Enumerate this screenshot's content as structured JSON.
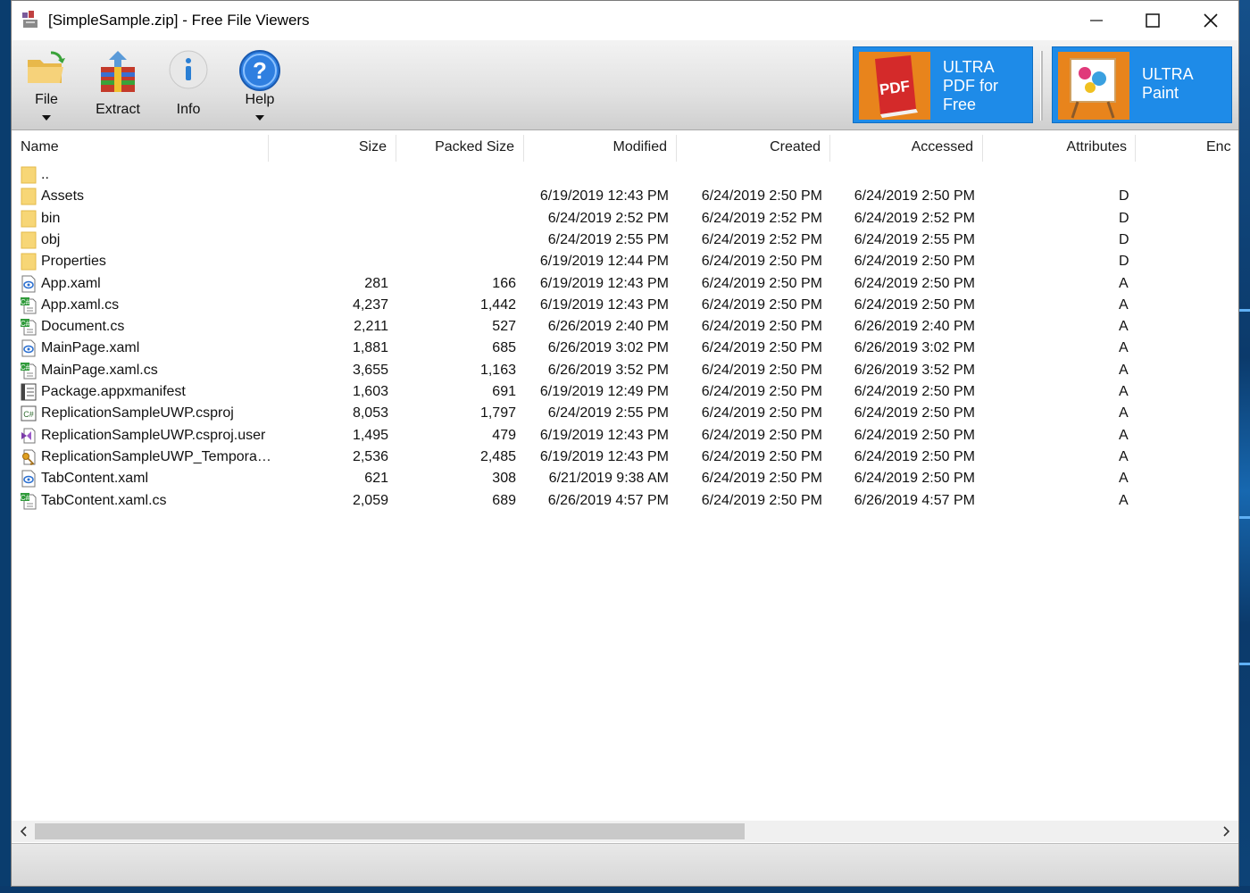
{
  "window": {
    "title": "[SimpleSample.zip] - Free File Viewers"
  },
  "toolbar": {
    "file_label": "File",
    "extract_label": "Extract",
    "info_label": "Info",
    "help_label": "Help"
  },
  "promos": [
    {
      "lines": [
        "ULTRA",
        "PDF for",
        "Free"
      ],
      "thumb_text": "PDF",
      "color": "#1e8be8"
    },
    {
      "lines": [
        "ULTRA",
        "Paint"
      ],
      "color": "#1e8be8"
    }
  ],
  "columns": [
    "Name",
    "Size",
    "Packed Size",
    "Modified",
    "Created",
    "Accessed",
    "Attributes",
    "Enc"
  ],
  "files": [
    {
      "name": "..",
      "size": "",
      "packed": "",
      "modified": "",
      "created": "",
      "accessed": "",
      "attr": "",
      "icon": "folder-icon"
    },
    {
      "name": "Assets",
      "size": "",
      "packed": "",
      "modified": "6/19/2019 12:43 PM",
      "created": "6/24/2019 2:50 PM",
      "accessed": "6/24/2019 2:50 PM",
      "attr": "D",
      "icon": "folder-icon"
    },
    {
      "name": "bin",
      "size": "",
      "packed": "",
      "modified": "6/24/2019 2:52 PM",
      "created": "6/24/2019 2:52 PM",
      "accessed": "6/24/2019 2:52 PM",
      "attr": "D",
      "icon": "folder-icon"
    },
    {
      "name": "obj",
      "size": "",
      "packed": "",
      "modified": "6/24/2019 2:55 PM",
      "created": "6/24/2019 2:52 PM",
      "accessed": "6/24/2019 2:55 PM",
      "attr": "D",
      "icon": "folder-icon"
    },
    {
      "name": "Properties",
      "size": "",
      "packed": "",
      "modified": "6/19/2019 12:44 PM",
      "created": "6/24/2019 2:50 PM",
      "accessed": "6/24/2019 2:50 PM",
      "attr": "D",
      "icon": "folder-icon"
    },
    {
      "name": "App.xaml",
      "size": "281",
      "packed": "166",
      "modified": "6/19/2019 12:43 PM",
      "created": "6/24/2019 2:50 PM",
      "accessed": "6/24/2019 2:50 PM",
      "attr": "A",
      "icon": "xaml-file-icon"
    },
    {
      "name": "App.xaml.cs",
      "size": "4,237",
      "packed": "1,442",
      "modified": "6/19/2019 12:43 PM",
      "created": "6/24/2019 2:50 PM",
      "accessed": "6/24/2019 2:50 PM",
      "attr": "A",
      "icon": "csharp-file-icon"
    },
    {
      "name": "Document.cs",
      "size": "2,211",
      "packed": "527",
      "modified": "6/26/2019 2:40 PM",
      "created": "6/24/2019 2:50 PM",
      "accessed": "6/26/2019 2:40 PM",
      "attr": "A",
      "icon": "csharp-file-icon"
    },
    {
      "name": "MainPage.xaml",
      "size": "1,881",
      "packed": "685",
      "modified": "6/26/2019 3:02 PM",
      "created": "6/24/2019 2:50 PM",
      "accessed": "6/26/2019 3:02 PM",
      "attr": "A",
      "icon": "xaml-file-icon"
    },
    {
      "name": "MainPage.xaml.cs",
      "size": "3,655",
      "packed": "1,163",
      "modified": "6/26/2019 3:52 PM",
      "created": "6/24/2019 2:50 PM",
      "accessed": "6/26/2019 3:52 PM",
      "attr": "A",
      "icon": "csharp-file-icon"
    },
    {
      "name": "Package.appxmanifest",
      "size": "1,603",
      "packed": "691",
      "modified": "6/19/2019 12:49 PM",
      "created": "6/24/2019 2:50 PM",
      "accessed": "6/24/2019 2:50 PM",
      "attr": "A",
      "icon": "manifest-file-icon"
    },
    {
      "name": "ReplicationSampleUWP.csproj",
      "size": "8,053",
      "packed": "1,797",
      "modified": "6/24/2019 2:55 PM",
      "created": "6/24/2019 2:50 PM",
      "accessed": "6/24/2019 2:50 PM",
      "attr": "A",
      "icon": "csproj-file-icon"
    },
    {
      "name": "ReplicationSampleUWP.csproj.user",
      "size": "1,495",
      "packed": "479",
      "modified": "6/19/2019 12:43 PM",
      "created": "6/24/2019 2:50 PM",
      "accessed": "6/24/2019 2:50 PM",
      "attr": "A",
      "icon": "vs-file-icon"
    },
    {
      "name": "ReplicationSampleUWP_Temporar…",
      "size": "2,536",
      "packed": "2,485",
      "modified": "6/19/2019 12:43 PM",
      "created": "6/24/2019 2:50 PM",
      "accessed": "6/24/2019 2:50 PM",
      "attr": "A",
      "icon": "key-file-icon"
    },
    {
      "name": "TabContent.xaml",
      "size": "621",
      "packed": "308",
      "modified": "6/21/2019 9:38 AM",
      "created": "6/24/2019 2:50 PM",
      "accessed": "6/24/2019 2:50 PM",
      "attr": "A",
      "icon": "xaml-file-icon"
    },
    {
      "name": "TabContent.xaml.cs",
      "size": "2,059",
      "packed": "689",
      "modified": "6/26/2019 4:57 PM",
      "created": "6/24/2019 2:50 PM",
      "accessed": "6/26/2019 4:57 PM",
      "attr": "A",
      "icon": "csharp-file-icon"
    }
  ]
}
